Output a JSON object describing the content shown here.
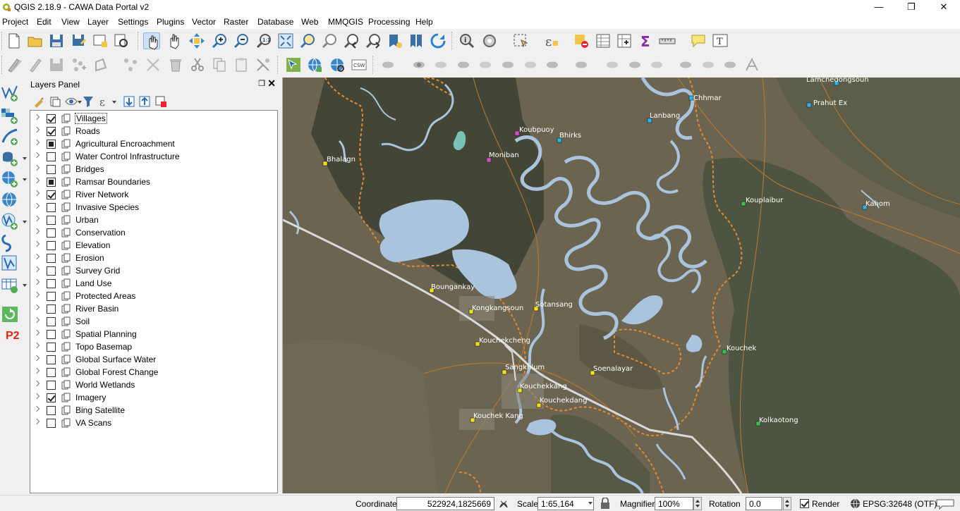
{
  "window": {
    "title": "QGIS 2.18.9 - CAWA Data Portal v2",
    "controls": [
      "—",
      "❐",
      "✕"
    ]
  },
  "menubar": [
    "Project",
    "Edit",
    "View",
    "Layer",
    "Settings",
    "Plugins",
    "Vector",
    "Raster",
    "Database",
    "Web",
    "MMQGIS",
    "Processing",
    "Help"
  ],
  "layers_panel": {
    "title": "Layers Panel",
    "float_glyph": "❐",
    "close_glyph": "✕",
    "layers": [
      {
        "name": "Villages",
        "state": "checked"
      },
      {
        "name": "Roads",
        "state": "checked"
      },
      {
        "name": "Agricultural Encroachment",
        "state": "partial"
      },
      {
        "name": "Water Control Infrastructure",
        "state": "unchecked"
      },
      {
        "name": "Bridges",
        "state": "unchecked"
      },
      {
        "name": "Ramsar Boundaries",
        "state": "partial"
      },
      {
        "name": "River Network",
        "state": "checked"
      },
      {
        "name": "Invasive Species",
        "state": "unchecked"
      },
      {
        "name": "Urban",
        "state": "unchecked"
      },
      {
        "name": "Conservation",
        "state": "unchecked"
      },
      {
        "name": "Elevation",
        "state": "unchecked"
      },
      {
        "name": "Erosion",
        "state": "unchecked"
      },
      {
        "name": "Survey Grid",
        "state": "unchecked"
      },
      {
        "name": "Land Use",
        "state": "unchecked"
      },
      {
        "name": "Protected Areas",
        "state": "unchecked"
      },
      {
        "name": "River Basin",
        "state": "unchecked"
      },
      {
        "name": "Soil",
        "state": "unchecked"
      },
      {
        "name": "Spatial Planning",
        "state": "unchecked"
      },
      {
        "name": "Topo Basemap",
        "state": "unchecked"
      },
      {
        "name": "Global Surface Water",
        "state": "unchecked"
      },
      {
        "name": "Global Forest Change",
        "state": "unchecked"
      },
      {
        "name": "World Wetlands",
        "state": "unchecked"
      },
      {
        "name": "Imagery",
        "state": "checked"
      },
      {
        "name": "Bing Satellite",
        "state": "unchecked"
      },
      {
        "name": "VA Scans",
        "state": "unchecked"
      }
    ]
  },
  "map": {
    "village_labels": [
      "Lamchedongsoun",
      "Prahut Ex",
      "Chhmar",
      "Lanbang",
      "Koubpuoy",
      "Bhirks",
      "Moniban",
      "Bhalagn",
      "Kouplaibur",
      "Kahom",
      "Boungankay",
      "Kongkangsoun",
      "Sotansang",
      "Kouchekcheng",
      "Kouchek",
      "Sangkhlum",
      "Soenalayar",
      "Kouchekkang",
      "Kouchekdang",
      "Kouchek Kang",
      "Kouchekdang",
      "Kolkaotong"
    ],
    "colors": {
      "water": "#a9c4dc",
      "village_yellow": "#f5e11b",
      "village_cyan": "#2ab6e8",
      "village_magenta": "#d44fcf",
      "village_green": "#35c24f",
      "ramsar_boundary": "#e5892e",
      "road": "#d9d9d9"
    }
  },
  "statusbar": {
    "coordinate_label": "Coordinate",
    "coordinate_value": "522924,1825669",
    "scale_label": "Scale",
    "scale_value": "1:65,164",
    "magnifier_label": "Magnifier",
    "magnifier_value": "100%",
    "rotation_label": "Rotation",
    "rotation_value": "0.0",
    "render_label": "Render",
    "crs_label": "EPSG:32648 (OTF)"
  },
  "toolbar": {
    "text_tool_glyph": "T"
  },
  "left_tools": {
    "plugin_p2": "P2"
  }
}
